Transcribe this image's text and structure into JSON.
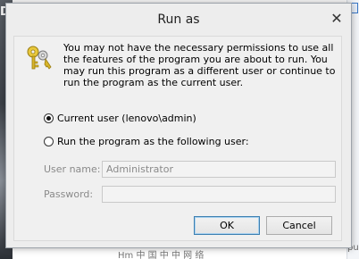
{
  "background": {
    "left_fragment": "DI",
    "bottom_fragment": "Hm 中 国 中 中 网 络",
    "right_fragment": "pusu"
  },
  "dialog": {
    "title": "Run as",
    "close_glyph": "✕",
    "icon": "keys-icon",
    "message": "You may not have the necessary permissions to use all the features of the program you are about to run. You may run this program as a different user or continue to run the program as the current user.",
    "options": {
      "current_user": "Current user (lenovo\\admin)",
      "other_user": "Run the program as the following user:"
    },
    "selected_option": "current_user",
    "fields": {
      "username_label": "User name:",
      "username_value": "Administrator",
      "password_label": "Password:",
      "password_value": ""
    },
    "buttons": {
      "ok": "OK",
      "cancel": "Cancel"
    }
  }
}
